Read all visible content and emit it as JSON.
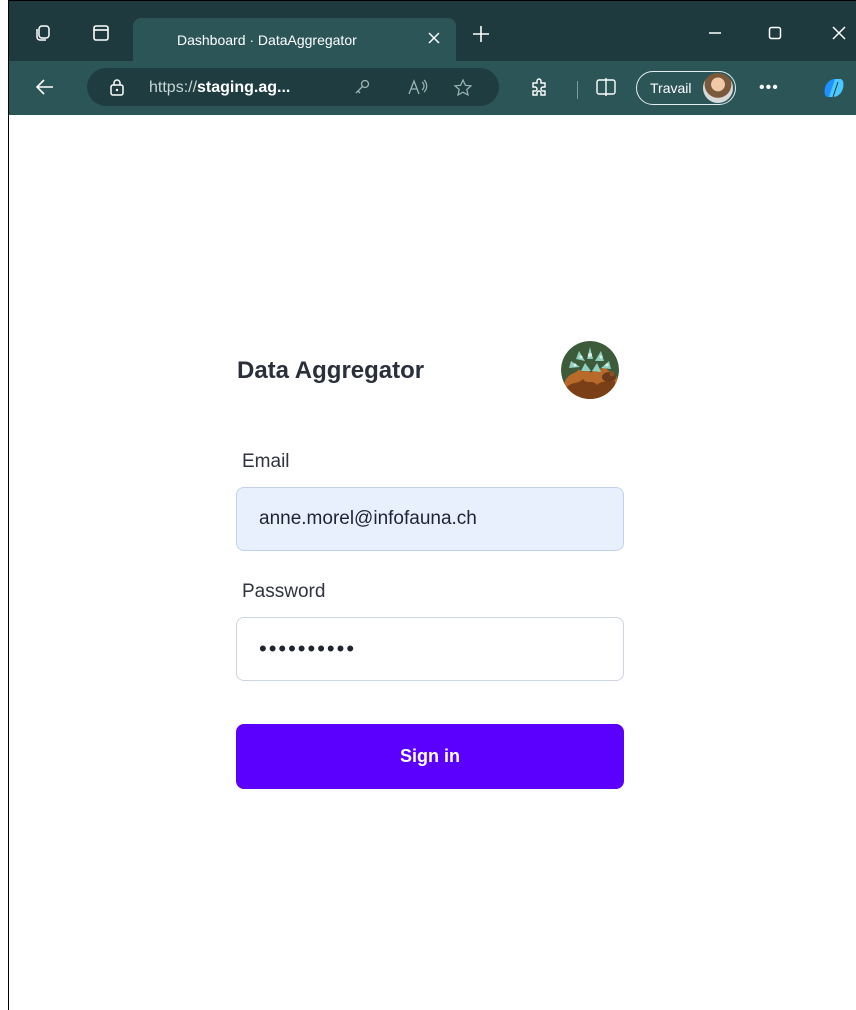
{
  "browser": {
    "tab_title": "Dashboard · DataAggregator",
    "address_prefix": "https://",
    "address_host": "staging.ag...",
    "profile_label": "Travail"
  },
  "app": {
    "title": "Data Aggregator",
    "email_label": "Email",
    "email_value": "anne.morel@infofauna.ch",
    "password_label": "Password",
    "password_value": "••••••••••",
    "signin_label": "Sign in"
  },
  "colors": {
    "titlebar": "#1f3a3e",
    "toolbar": "#2c5557",
    "accent": "#5b00ff",
    "email_bg": "#e8f0fe"
  }
}
